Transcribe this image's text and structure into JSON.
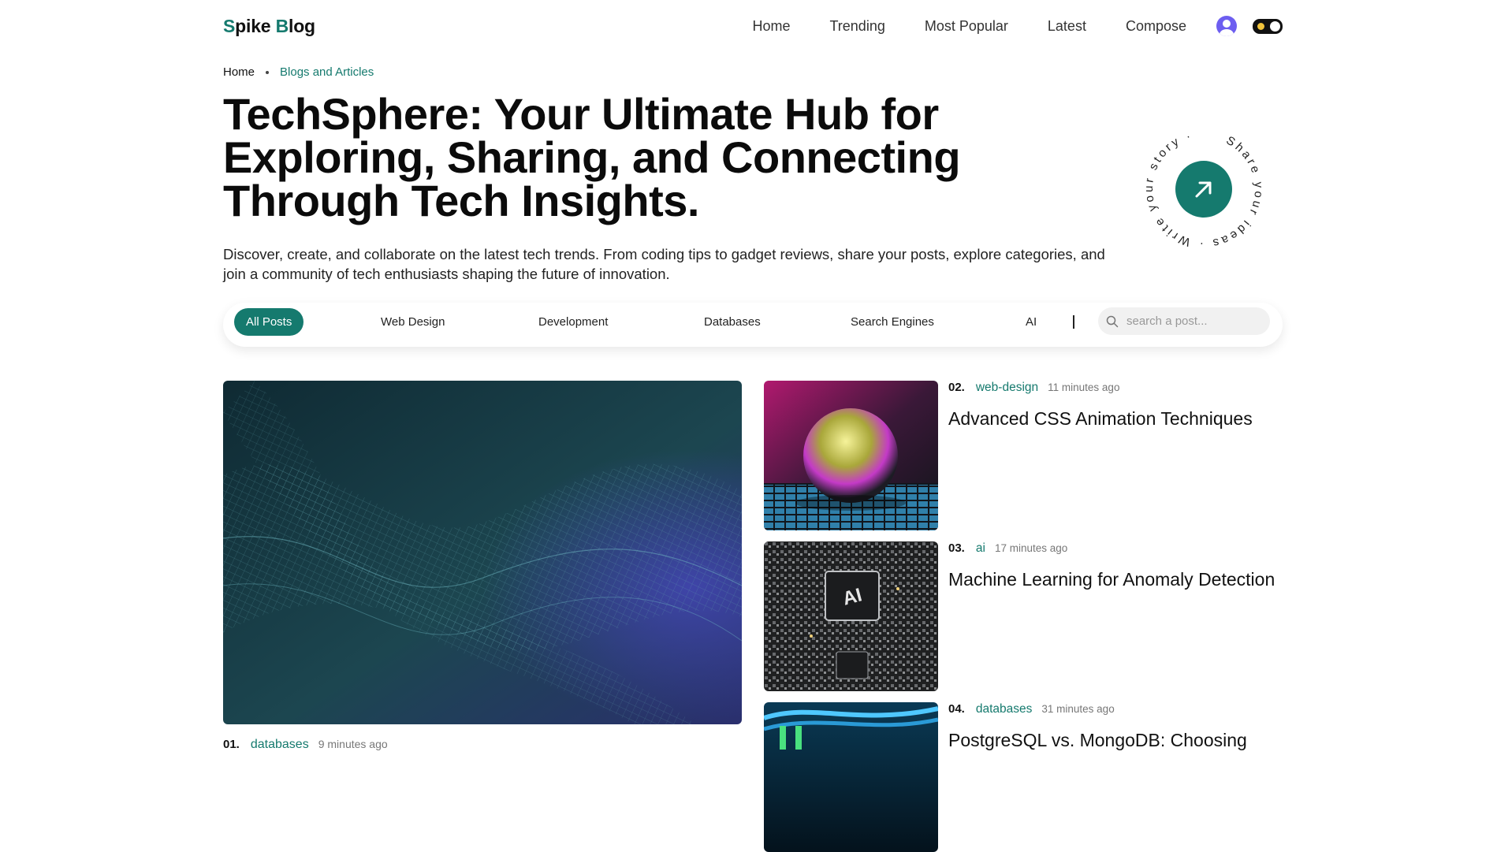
{
  "brand": {
    "logo_s": "S",
    "logo_pike": "pike ",
    "logo_b": "B",
    "logo_log": "log"
  },
  "nav": {
    "items": [
      "Home",
      "Trending",
      "Most Popular",
      "Latest",
      "Compose"
    ]
  },
  "breadcrumb": {
    "home": "Home",
    "current": "Blogs and Articles"
  },
  "hero": {
    "title": "TechSphere: Your Ultimate Hub for Exploring, Sharing, and Connecting Through Tech Insights.",
    "description": "Discover, create, and collaborate on the latest tech trends. From coding tips to gadget reviews, share your posts, explore categories, and join a community of tech enthusiasts shaping the future of innovation.",
    "badge_text": "Share your ideas · Write your story ·"
  },
  "filters": {
    "active": "All Posts",
    "categories": [
      "Web Design",
      "Development",
      "Databases",
      "Search Engines",
      "AI"
    ],
    "search_placeholder": "search a post..."
  },
  "posts": [
    {
      "num": "01.",
      "tag": "databases",
      "time": "9 minutes ago",
      "title": ""
    },
    {
      "num": "02.",
      "tag": "web-design",
      "time": "11 minutes ago",
      "title": "Advanced CSS Animation Techniques"
    },
    {
      "num": "03.",
      "tag": "ai",
      "time": "17 minutes ago",
      "title": "Machine Learning for Anomaly Detection"
    },
    {
      "num": "04.",
      "tag": "databases",
      "time": "31 minutes ago",
      "title": "PostgreSQL vs. MongoDB: Choosing"
    }
  ],
  "colors": {
    "accent": "#157a6e",
    "text": "#111111",
    "avatar": "#6d5ef0"
  },
  "icons": {
    "user": "user-avatar-icon",
    "theme": "theme-toggle-icon",
    "search": "search-icon",
    "badge": "arrow-up-right-icon"
  }
}
